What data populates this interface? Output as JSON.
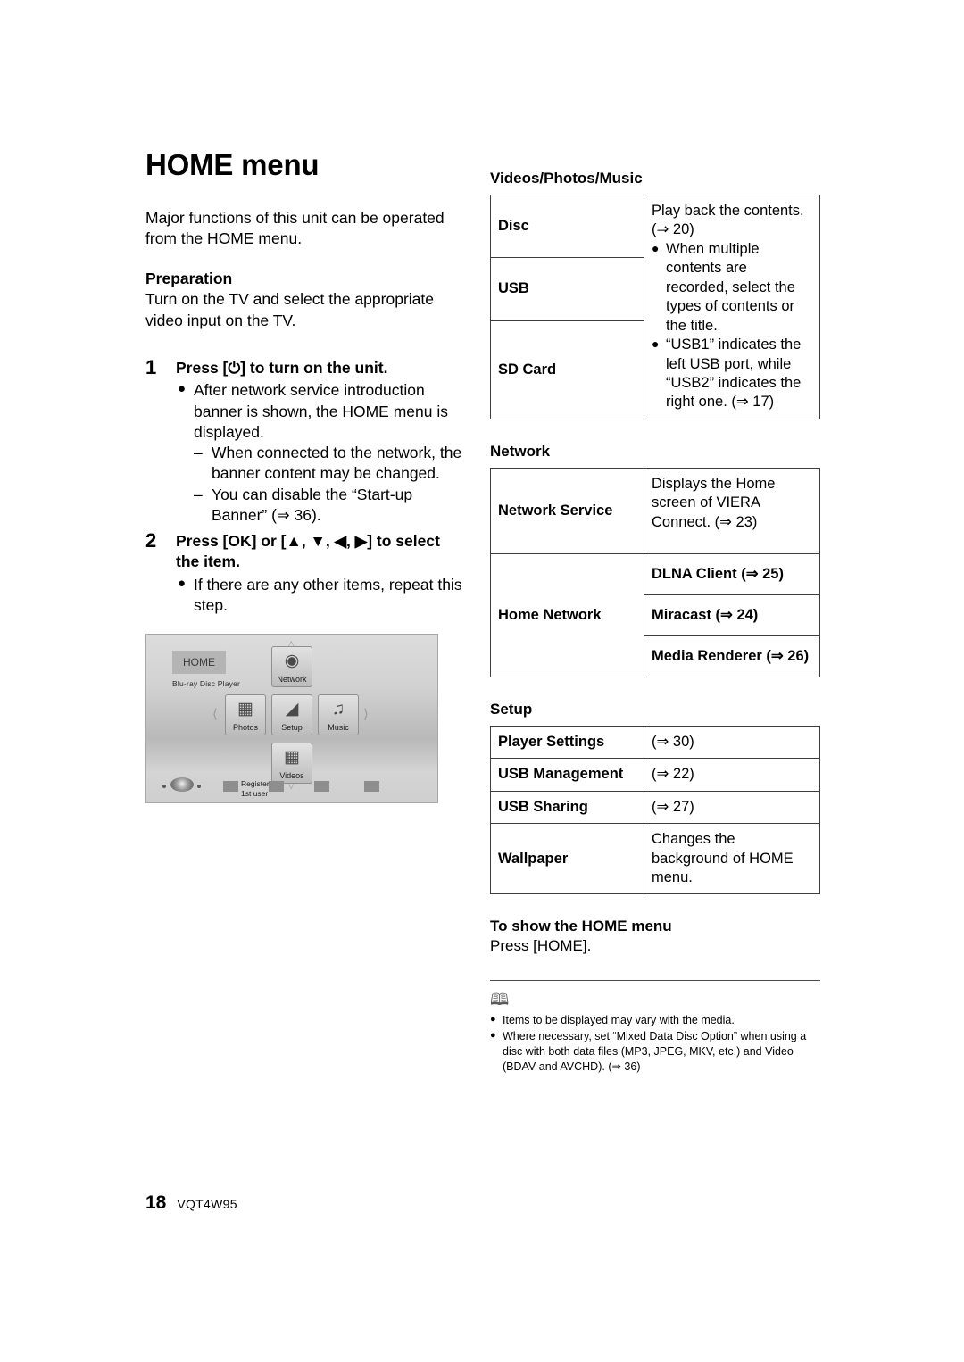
{
  "document": {
    "title": "HOME menu",
    "intro": "Major functions of this unit can be operated from the HOME menu.",
    "preparation_heading": "Preparation",
    "preparation_text": "Turn on the TV and select the appropriate video input on the TV.",
    "footer": {
      "page_number": "18",
      "code": "VQT4W95"
    }
  },
  "steps": [
    {
      "number": "1",
      "title": "Press [⏻] to turn on the unit.",
      "bullets": [
        "After network service introduction banner is shown, the HOME menu is displayed."
      ],
      "subitems": [
        "When connected to the network, the banner content may be changed.",
        "You can disable the “Start-up Banner” (⇒ 36)."
      ]
    },
    {
      "number": "2",
      "title": "Press [OK] or [▲, ▼, ◀, ▶] to select the item.",
      "bullets": [
        "If there are any other items, repeat this step."
      ],
      "subitems": []
    }
  ],
  "screenshot": {
    "home_badge": "HOME",
    "subtitle": "Blu-ray Disc Player",
    "tiles": [
      {
        "label": "Network",
        "icon": "network-globe-icon"
      },
      {
        "label": "Photos",
        "icon": "photos-stack-icon"
      },
      {
        "label": "Setup",
        "icon": "setup-wrench-icon"
      },
      {
        "label": "Music",
        "icon": "music-note-icon"
      },
      {
        "label": "Videos",
        "icon": "videos-film-icon"
      }
    ],
    "color_button_label": "Register\n1st user"
  },
  "tables": [
    {
      "heading": "Videos/Photos/Music",
      "layout": "merged-right",
      "rows": [
        {
          "label": "Disc"
        },
        {
          "label": "USB"
        },
        {
          "label": "SD Card"
        }
      ],
      "merged_value": {
        "lead": "Play back the contents. (⇒ 20)",
        "bullets": [
          "When multiple contents are recorded, select the types of contents or the title.",
          "“USB1” indicates the left USB port, while “USB2” indicates the right one. (⇒ 17)"
        ]
      }
    },
    {
      "heading": "Network",
      "layout": "grouped",
      "rows": [
        {
          "label": "Network Service",
          "value": "Displays the Home screen of VIERA Connect. (⇒ 23)",
          "bold_value": false
        },
        {
          "label": "Home Network",
          "subrows": [
            {
              "value": "DLNA Client (⇒ 25)",
              "bold_value": true
            },
            {
              "value": "Miracast (⇒ 24)",
              "bold_value": true
            },
            {
              "value": "Media Renderer (⇒ 26)",
              "bold_value": true
            }
          ]
        }
      ]
    },
    {
      "heading": "Setup",
      "layout": "simple",
      "rows": [
        {
          "label": "Player Settings",
          "value": "(⇒ 30)"
        },
        {
          "label": "USB Management",
          "value": "(⇒ 22)"
        },
        {
          "label": "USB Sharing",
          "value": "(⇒ 27)"
        },
        {
          "label": "Wallpaper",
          "value": "Changes the background of HOME menu."
        }
      ]
    }
  ],
  "show_menu": {
    "heading": "To show the HOME menu",
    "text": "Press [HOME]."
  },
  "notes": {
    "icon": "book-note-icon",
    "items": [
      "Items to be displayed may vary with the media.",
      "Where necessary, set “Mixed Data Disc Option” when using a disc with both data files (MP3, JPEG, MKV, etc.) and Video (BDAV and AVCHD). (⇒ 36)"
    ]
  }
}
